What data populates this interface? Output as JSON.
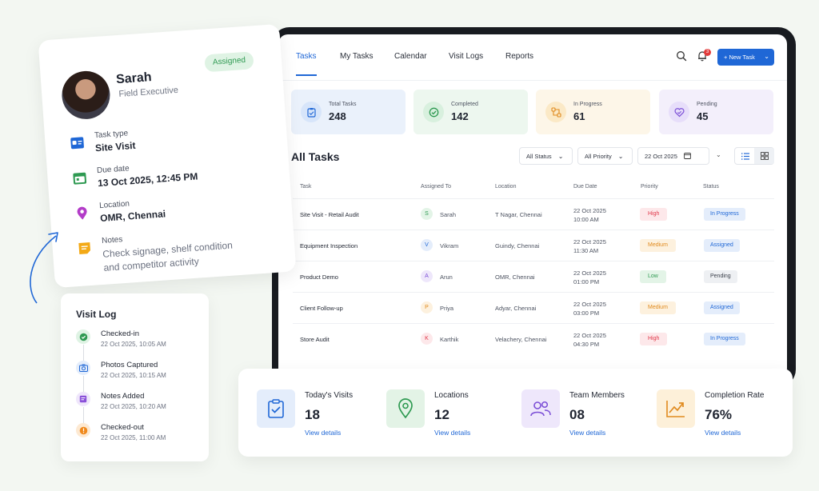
{
  "nav": {
    "tabs": [
      "Tasks",
      "My Tasks",
      "Calendar",
      "Visit Logs",
      "Reports"
    ],
    "active_tab": "Tasks",
    "notification_count": "3",
    "new_task_label": "+ New Task"
  },
  "stats": [
    {
      "label": "Total Tasks",
      "value": "248",
      "bg": "#eaf1fb",
      "icon_bg": "#d7e5fa",
      "icon_color": "#1f67d6",
      "icon": "clipboard-icon"
    },
    {
      "label": "Completed",
      "value": "142",
      "bg": "#edf7ef",
      "icon_bg": "#d8f0de",
      "icon_color": "#2f9a52",
      "icon": "check-circle-icon"
    },
    {
      "label": "In Progress",
      "value": "61",
      "bg": "#fdf6e8",
      "icon_bg": "#fbe9c6",
      "icon_color": "#e08a1e",
      "icon": "workflow-icon"
    },
    {
      "label": "Pending",
      "value": "45",
      "bg": "#f3effb",
      "icon_bg": "#e7defa",
      "icon_color": "#7b4ed6",
      "icon": "heart-check-icon"
    }
  ],
  "tasks_section": {
    "title": "All Tasks",
    "filters": {
      "status": "All Status",
      "priority": "All Priority",
      "date": "22 Oct 2025"
    },
    "columns": [
      "Task",
      "Assigned To",
      "Location",
      "Due Date",
      "Priority",
      "Status"
    ],
    "rows": [
      {
        "task": "Site Visit - Retail Audit",
        "initial": "S",
        "assignee": "Sarah",
        "location": "T Nagar, Chennai",
        "due_date": "22 Oct 2025",
        "due_time": "10:00 AM",
        "priority": "High",
        "status": "In Progress"
      },
      {
        "task": "Equipment Inspection",
        "initial": "V",
        "assignee": "Vikram",
        "location": "Guindy, Chennai",
        "due_date": "22 Oct 2025",
        "due_time": "11:30 AM",
        "priority": "Medium",
        "status": "Assigned"
      },
      {
        "task": "Product Demo",
        "initial": "A",
        "assignee": "Arun",
        "location": "OMR, Chennai",
        "due_date": "22 Oct 2025",
        "due_time": "01:00 PM",
        "priority": "Low",
        "status": "Pending"
      },
      {
        "task": "Client Follow-up",
        "initial": "P",
        "assignee": "Priya",
        "location": "Adyar, Chennai",
        "due_date": "22 Oct 2025",
        "due_time": "03:00 PM",
        "priority": "Medium",
        "status": "Assigned"
      },
      {
        "task": "Store Audit",
        "initial": "K",
        "assignee": "Karthik",
        "location": "Velachery, Chennai",
        "due_date": "22 Oct 2025",
        "due_time": "04:30 PM",
        "priority": "High",
        "status": "In Progress"
      }
    ]
  },
  "profile": {
    "name": "Sarah",
    "role": "Field Executive",
    "badge": "Assigned",
    "task_type_label": "Task type",
    "task_type": "Site Visit",
    "due_label": "Due date",
    "due": "13 Oct 2025, 12:45 PM",
    "location_label": "Location",
    "location": "OMR, Chennai",
    "notes_label": "Notes",
    "notes_line1": "Check signage, shelf condition",
    "notes_line2": "and competitor activity"
  },
  "visit_log": {
    "title": "Visit Log",
    "items": [
      {
        "name": "Checked-in",
        "time": "22 Oct 2025, 10:05 AM"
      },
      {
        "name": "Photos Captured",
        "time": "22 Oct 2025, 10:15 AM"
      },
      {
        "name": "Notes Added",
        "time": "22 Oct 2025, 10:20 AM"
      },
      {
        "name": "Checked-out",
        "time": "22 Oct 2025, 11:00 AM"
      }
    ]
  },
  "summary": [
    {
      "label": "Today's Visits",
      "value": "18",
      "link": "View details"
    },
    {
      "label": "Locations",
      "value": "12",
      "link": "View details"
    },
    {
      "label": "Team Members",
      "value": "08",
      "link": "View details"
    },
    {
      "label": "Completion Rate",
      "value": "76%",
      "link": "View details"
    }
  ],
  "colors": {
    "accent": "#1f67d6",
    "high": "#e0384a",
    "medium": "#e08a1e",
    "low": "#2f9a52"
  }
}
